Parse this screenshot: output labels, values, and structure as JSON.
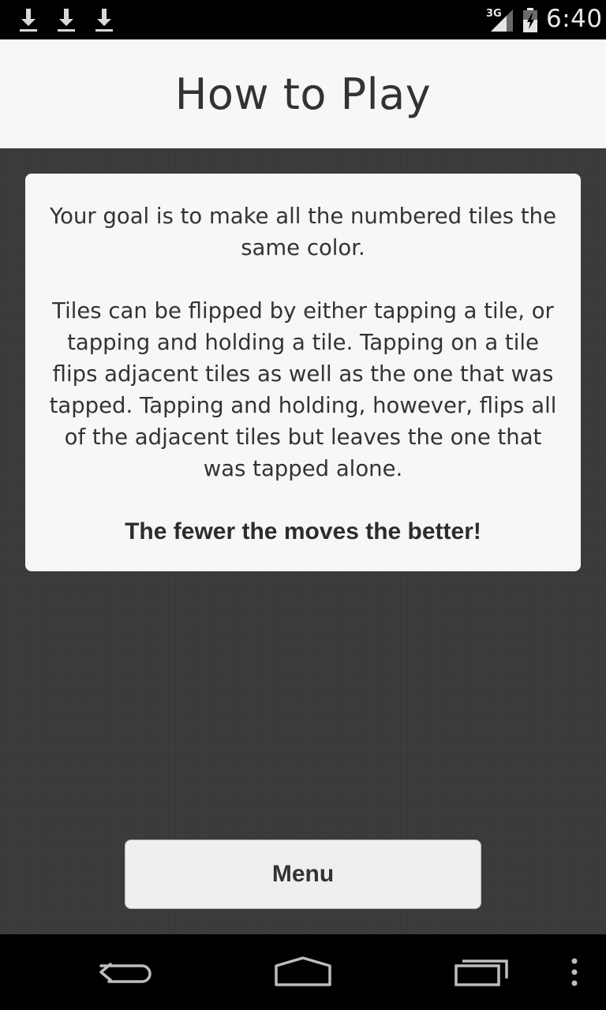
{
  "status_bar": {
    "time": "6:40",
    "network": "3G",
    "icons": [
      "download-icon",
      "download-icon",
      "download-icon",
      "signal-icon",
      "battery-icon"
    ]
  },
  "header": {
    "title": "How to Play"
  },
  "instructions": {
    "paragraphs": [
      "Your goal is to make all the numbered tiles the same color.",
      "Tiles can be flipped by either tapping a tile, or tapping and holding a tile. Tapping on a tile flips adjacent tiles as well as the one that was tapped. Tapping and holding, however, flips all of the adjacent tiles but leaves the one that was tapped alone."
    ],
    "emphasis": "The fewer the moves the better!"
  },
  "menu_button": {
    "label": "Menu"
  },
  "nav_bar": {
    "icons": [
      "back-icon",
      "home-icon",
      "recent-apps-icon",
      "overflow-menu-icon"
    ]
  },
  "colors": {
    "status_bar": "#000000",
    "header_bg": "#f7f7f7",
    "background": "#3b3b3b",
    "card_bg": "#f7f7f7",
    "text": "#333333"
  }
}
